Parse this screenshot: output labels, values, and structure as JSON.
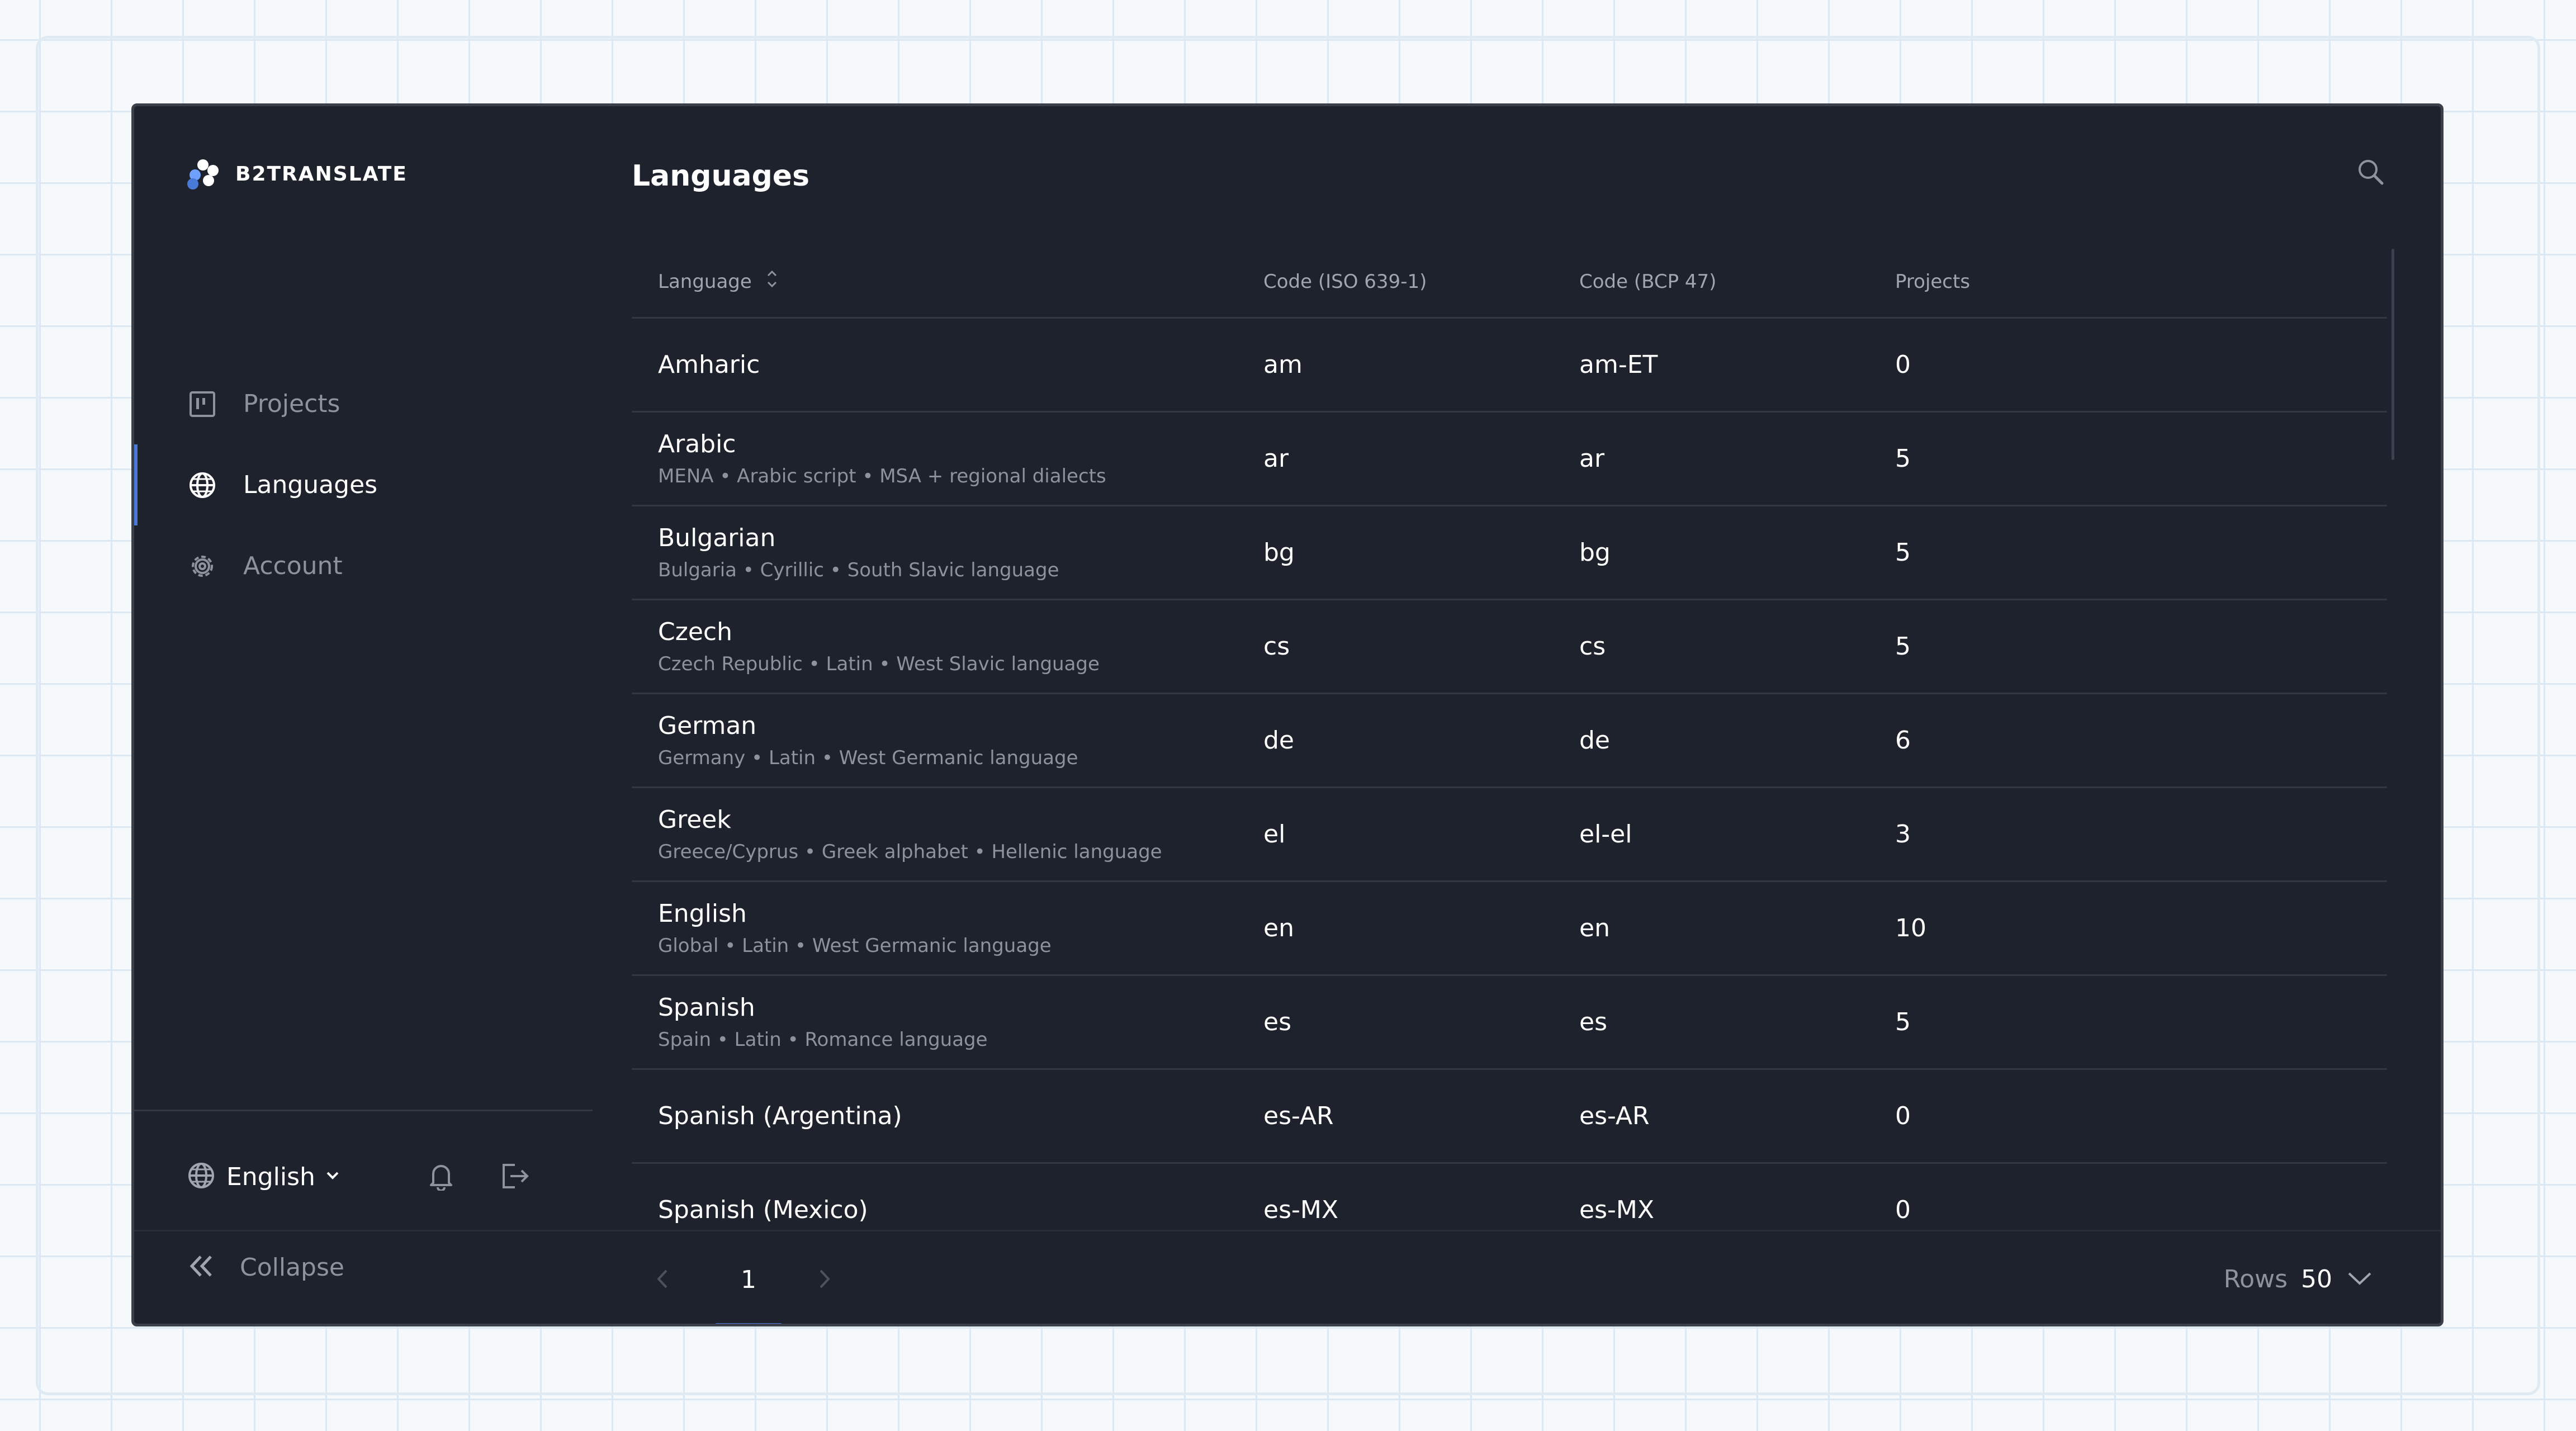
{
  "brand": {
    "name": "B2TRANSLATE"
  },
  "sidebar": {
    "items": [
      {
        "label": "Projects",
        "icon": "projects-board-icon"
      },
      {
        "label": "Languages",
        "icon": "globe-icon"
      },
      {
        "label": "Account",
        "icon": "gear-icon"
      }
    ],
    "active": "Languages",
    "language_select": {
      "value": "English"
    },
    "collapse_label": "Collapse"
  },
  "page": {
    "title": "Languages"
  },
  "table": {
    "columns": [
      "Language",
      "Code (ISO 639-1)",
      "Code (BCP 47)",
      "Projects"
    ],
    "rows": [
      {
        "name": "Amharic",
        "meta": "",
        "iso": "am",
        "bcp": "am-ET",
        "projects": "0"
      },
      {
        "name": "Arabic",
        "meta": "MENA • Arabic script • MSA + regional dialects",
        "iso": "ar",
        "bcp": "ar",
        "projects": "5"
      },
      {
        "name": "Bulgarian",
        "meta": "Bulgaria • Cyrillic • South Slavic language",
        "iso": "bg",
        "bcp": "bg",
        "projects": "5"
      },
      {
        "name": "Czech",
        "meta": "Czech Republic • Latin • West Slavic language",
        "iso": "cs",
        "bcp": "cs",
        "projects": "5"
      },
      {
        "name": "German",
        "meta": "Germany • Latin • West Germanic language",
        "iso": "de",
        "bcp": "de",
        "projects": "6"
      },
      {
        "name": "Greek",
        "meta": "Greece/Cyprus • Greek alphabet • Hellenic language",
        "iso": "el",
        "bcp": "el-el",
        "projects": "3"
      },
      {
        "name": "English",
        "meta": "Global • Latin • West Germanic language",
        "iso": "en",
        "bcp": "en",
        "projects": "10"
      },
      {
        "name": "Spanish",
        "meta": "Spain • Latin • Romance language",
        "iso": "es",
        "bcp": "es",
        "projects": "5"
      },
      {
        "name": "Spanish (Argentina)",
        "meta": "",
        "iso": "es-AR",
        "bcp": "es-AR",
        "projects": "0"
      },
      {
        "name": "Spanish (Mexico)",
        "meta": "",
        "iso": "es-MX",
        "bcp": "es-MX",
        "projects": "0"
      }
    ]
  },
  "pagination": {
    "current_page": "1",
    "rows_label": "Rows",
    "rows_value": "50"
  },
  "colors": {
    "app_bg": "#1e222c",
    "accent": "#4a7ad8",
    "muted_text": "#8d929c",
    "divider": "#323743"
  }
}
